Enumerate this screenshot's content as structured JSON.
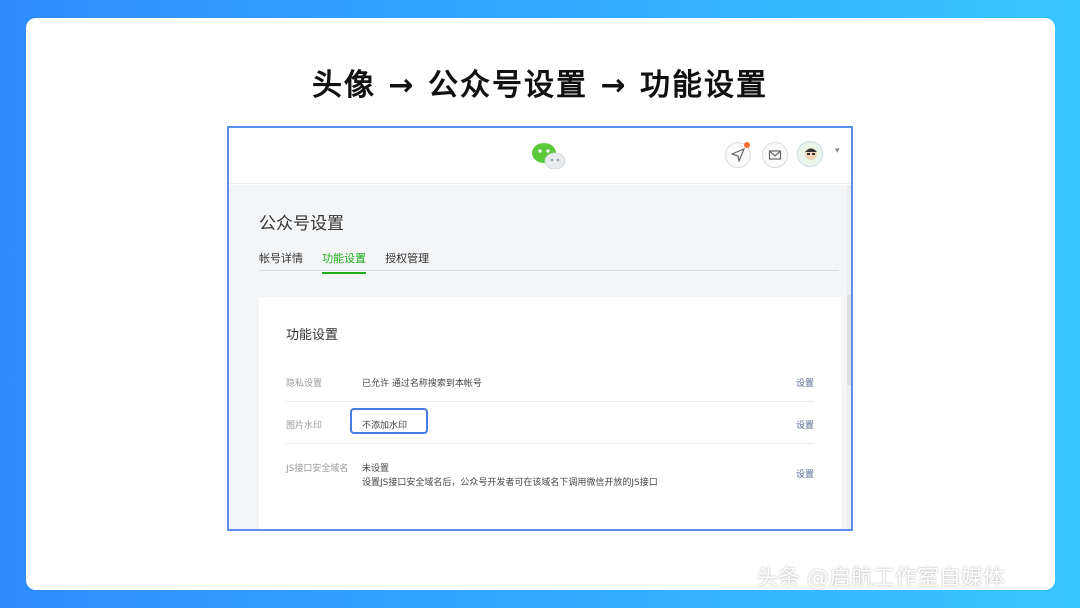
{
  "headline": "头像 → 公众号设置 → 功能设置",
  "screenshot": {
    "page_title": "公众号设置",
    "tabs": [
      {
        "label": "帐号详情",
        "active": false
      },
      {
        "label": "功能设置",
        "active": true
      },
      {
        "label": "授权管理",
        "active": false
      }
    ],
    "panel": {
      "title": "功能设置",
      "rows": [
        {
          "label": "隐私设置",
          "value": "已允许 通过名称搜索到本帐号",
          "action": "设置"
        },
        {
          "label": "图片水印",
          "value": "不添加水印",
          "action": "设置"
        },
        {
          "label": "JS接口安全域名",
          "value": "未设置",
          "value_line2": "设置JS接口安全域名后，公众号开发者可在该域名下调用微信开放的JS接口",
          "action": "设置"
        }
      ]
    }
  },
  "watermark": "头条 @启航工作室自媒体",
  "colors": {
    "accent_green": "#1aad19",
    "highlight_blue": "#4a7be2",
    "link": "#576b95"
  }
}
